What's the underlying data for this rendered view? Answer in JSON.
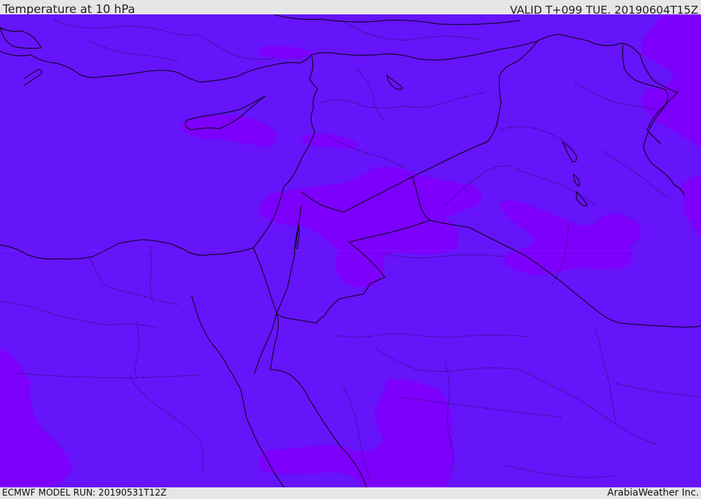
{
  "header": {
    "title": "Temperature at 10 hPa",
    "valid": "VALID T+099 TUE. 20190604T15Z"
  },
  "footer": {
    "model_run": "ECMWF MODEL RUN: 20190531T12Z",
    "credit": "ArabiaWeather Inc."
  },
  "map": {
    "colors": {
      "base_fill": "#6614fa",
      "warm_fill": "#7d00fd",
      "border": "#000000"
    }
  }
}
